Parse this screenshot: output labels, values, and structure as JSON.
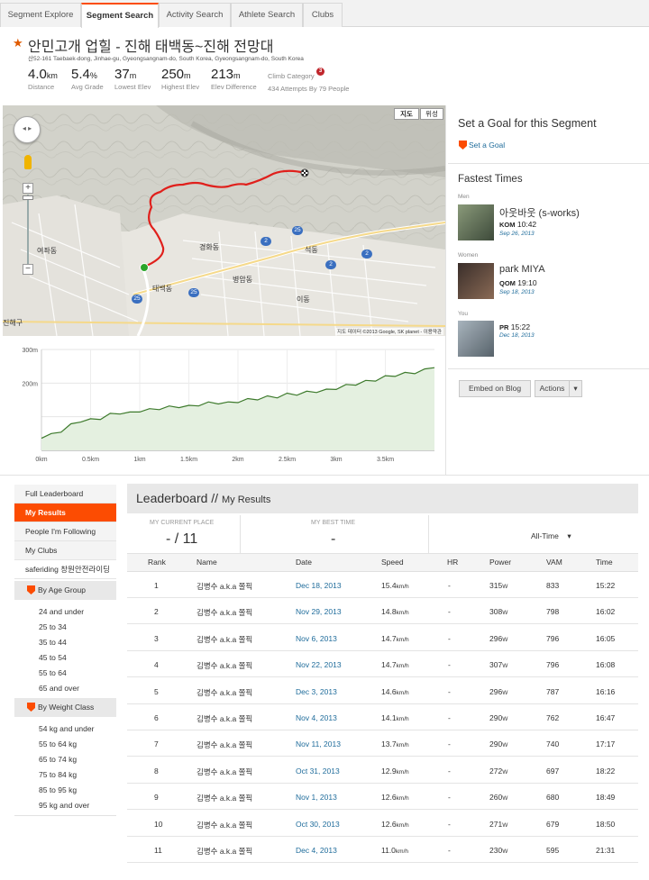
{
  "tabs": [
    {
      "label": "Segment Explore",
      "active": false
    },
    {
      "label": "Segment Search",
      "active": true
    },
    {
      "label": "Activity Search",
      "active": false
    },
    {
      "label": "Athlete Search",
      "active": false
    },
    {
      "label": "Clubs",
      "active": false
    }
  ],
  "segment": {
    "title": "안민고개 업힐 - 진해 태백동~진해 전망대",
    "address": "산52-161 Taebaek-dong, Jinhae-gu, Gyeongsangnam-do, South Korea, Gyeongsangnam-do, South Korea",
    "stats": [
      {
        "value": "4.0",
        "unit": "km",
        "label": "Distance"
      },
      {
        "value": "5.4",
        "unit": "%",
        "label": "Avg Grade"
      },
      {
        "value": "37",
        "unit": "m",
        "label": "Lowest Elev"
      },
      {
        "value": "250",
        "unit": "m",
        "label": "Highest Elev"
      },
      {
        "value": "213",
        "unit": "m",
        "label": "Elev Difference"
      }
    ],
    "climb_category_label": "Climb Category",
    "climb_category_value": "3",
    "attempts": "434 Attempts By 79 People"
  },
  "map": {
    "type_map": "지도",
    "type_satellite": "위성",
    "attribution": "지도 데이터 ©2013 Google, SK planet - 이용약관",
    "labels": {
      "yeojwa": "여좌동",
      "gyeonghwa": "경화동",
      "seok": "석동",
      "taebaek": "태백동",
      "byeongam": "병암동",
      "i": "이동",
      "jinhae": "진해구"
    },
    "route_shields": [
      "2",
      "25",
      "2",
      "2",
      "25",
      "25"
    ]
  },
  "elevation_chart": {
    "chart_data": {
      "type": "area",
      "x": [
        0,
        0.1,
        0.2,
        0.3,
        0.4,
        0.5,
        0.6,
        0.7,
        0.8,
        0.9,
        1.0,
        1.1,
        1.2,
        1.3,
        1.4,
        1.5,
        1.6,
        1.7,
        1.8,
        1.9,
        2.0,
        2.1,
        2.2,
        2.3,
        2.4,
        2.5,
        2.6,
        2.7,
        2.8,
        2.9,
        3.0,
        3.1,
        3.2,
        3.3,
        3.4,
        3.5,
        3.6,
        3.7,
        3.8,
        3.9,
        4.0
      ],
      "y": [
        40,
        46,
        58,
        75,
        88,
        90,
        96,
        106,
        112,
        110,
        118,
        120,
        125,
        128,
        131,
        130,
        136,
        140,
        142,
        140,
        146,
        150,
        154,
        158,
        160,
        166,
        168,
        172,
        176,
        178,
        185,
        192,
        198,
        204,
        210,
        218,
        224,
        228,
        232,
        238,
        250
      ],
      "xlabel": "",
      "ylabel": "",
      "x_ticks": [
        "0km",
        "0.5km",
        "1km",
        "1.5km",
        "2km",
        "2.5km",
        "3km",
        "3.5km"
      ],
      "y_ticks": [
        "300m",
        "200m"
      ],
      "xlim": [
        0,
        4.0
      ],
      "ylim": [
        0,
        300
      ],
      "grid": true
    }
  },
  "goal": {
    "title": "Set a Goal for this Segment",
    "link": "Set a Goal"
  },
  "fastest": {
    "title": "Fastest Times",
    "entries": [
      {
        "section": "Men",
        "name": "아웃바웃 (s-works)",
        "rank": "KOM",
        "time": "10:42",
        "date": "Sep 26, 2013"
      },
      {
        "section": "Women",
        "name": "park MIYA",
        "rank": "QOM",
        "time": "19:10",
        "date": "Sep 18, 2013"
      },
      {
        "section": "You",
        "name": "",
        "rank": "PR",
        "time": "15:22",
        "date": "Dec 18, 2013"
      }
    ]
  },
  "actions": {
    "embed": "Embed on Blog",
    "actions": "Actions",
    "caret": "▾"
  },
  "sidebar": {
    "items": [
      {
        "label": "Full Leaderboard",
        "active": false
      },
      {
        "label": "My Results",
        "active": true
      },
      {
        "label": "People I'm Following",
        "active": false
      },
      {
        "label": "My Clubs",
        "active": false
      },
      {
        "label": "saferiding 창원안전라이딩",
        "active": false
      }
    ],
    "age_group_title": "By Age Group",
    "age_groups": [
      "24 and under",
      "25 to 34",
      "35 to 44",
      "45 to 54",
      "55 to 64",
      "65 and over"
    ],
    "weight_title": "By Weight Class",
    "weight_classes": [
      "54 kg and under",
      "55 to 64 kg",
      "65 to 74 kg",
      "75 to 84 kg",
      "85 to 95 kg",
      "95 kg and over"
    ]
  },
  "leaderboard": {
    "title": "Leaderboard",
    "separator": "//",
    "subtitle": "My Results",
    "current_place_label": "MY CURRENT PLACE",
    "current_place_value": "- / 11",
    "best_time_label": "MY BEST TIME",
    "best_time_value": "-",
    "filter": "All-Time",
    "filter_caret": "▾",
    "columns": [
      "Rank",
      "Name",
      "Date",
      "Speed",
      "HR",
      "Power",
      "VAM",
      "Time"
    ],
    "rows": [
      {
        "rank": "1",
        "name": "김병수 a.k.a 쫄픽",
        "date": "Dec 18, 2013",
        "speed": "15.4",
        "hr": "-",
        "power": "315",
        "vam": "833",
        "time": "15:22"
      },
      {
        "rank": "2",
        "name": "김병수 a.k.a 쫄픽",
        "date": "Nov 29, 2013",
        "speed": "14.8",
        "hr": "-",
        "power": "308",
        "vam": "798",
        "time": "16:02"
      },
      {
        "rank": "3",
        "name": "김병수 a.k.a 쫄픽",
        "date": "Nov 6, 2013",
        "speed": "14.7",
        "hr": "-",
        "power": "296",
        "vam": "796",
        "time": "16:05"
      },
      {
        "rank": "4",
        "name": "김병수 a.k.a 쫄픽",
        "date": "Nov 22, 2013",
        "speed": "14.7",
        "hr": "-",
        "power": "307",
        "vam": "796",
        "time": "16:08"
      },
      {
        "rank": "5",
        "name": "김병수 a.k.a 쫄픽",
        "date": "Dec 3, 2013",
        "speed": "14.6",
        "hr": "-",
        "power": "296",
        "vam": "787",
        "time": "16:16"
      },
      {
        "rank": "6",
        "name": "김병수 a.k.a 쫄픽",
        "date": "Nov 4, 2013",
        "speed": "14.1",
        "hr": "-",
        "power": "290",
        "vam": "762",
        "time": "16:47"
      },
      {
        "rank": "7",
        "name": "김병수 a.k.a 쫄픽",
        "date": "Nov 11, 2013",
        "speed": "13.7",
        "hr": "-",
        "power": "290",
        "vam": "740",
        "time": "17:17"
      },
      {
        "rank": "8",
        "name": "김병수 a.k.a 쫄픽",
        "date": "Oct 31, 2013",
        "speed": "12.9",
        "hr": "-",
        "power": "272",
        "vam": "697",
        "time": "18:22"
      },
      {
        "rank": "9",
        "name": "김병수 a.k.a 쫄픽",
        "date": "Nov 1, 2013",
        "speed": "12.6",
        "hr": "-",
        "power": "260",
        "vam": "680",
        "time": "18:49"
      },
      {
        "rank": "10",
        "name": "김병수 a.k.a 쫄픽",
        "date": "Oct 30, 2013",
        "speed": "12.6",
        "hr": "-",
        "power": "271",
        "vam": "679",
        "time": "18:50"
      },
      {
        "rank": "11",
        "name": "김병수 a.k.a 쫄픽",
        "date": "Dec 4, 2013",
        "speed": "11.0",
        "hr": "-",
        "power": "230",
        "vam": "595",
        "time": "21:31"
      }
    ],
    "speed_unit": "km/h",
    "power_unit": "W"
  },
  "colors": {
    "accent": "#fc4c02",
    "link": "#1f6c9b",
    "route": "#e0201c",
    "elev_line": "#3d7a2c",
    "elev_fill": "#e4f0e0",
    "climb_badge": "#c0262c"
  }
}
